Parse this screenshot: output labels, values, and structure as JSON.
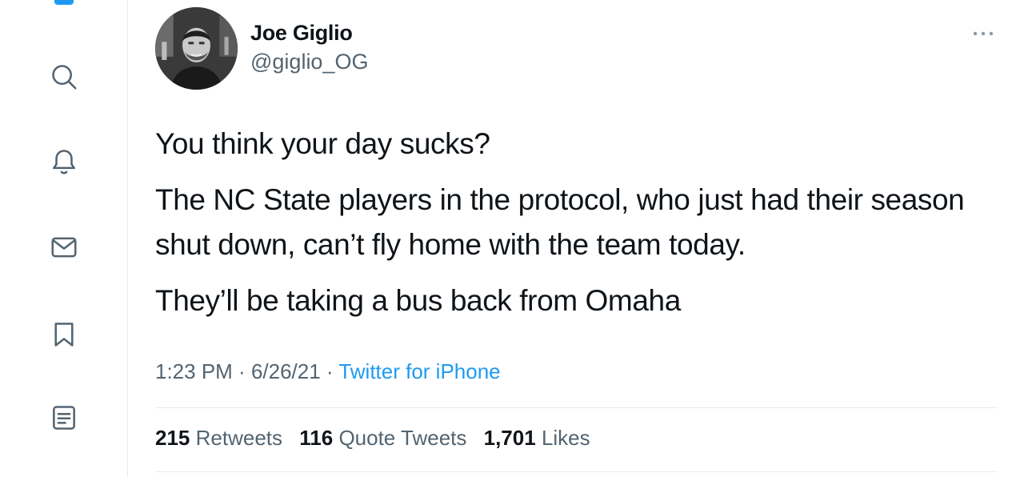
{
  "nav": {
    "icons": [
      "search-icon",
      "bell-icon",
      "mail-icon",
      "bookmark-icon",
      "list-icon"
    ]
  },
  "tweet": {
    "author": {
      "display_name": "Joe Giglio",
      "handle": "@giglio_OG"
    },
    "paragraphs": [
      "You think your day sucks?",
      "The NC State players in the protocol, who just had their season shut down, can’t fly home with the team today.",
      "They’ll be taking a bus back from Omaha"
    ],
    "time": "1:23 PM",
    "date": "6/26/21",
    "separator": " · ",
    "source": "Twitter for iPhone",
    "stats": {
      "retweets": "215",
      "retweets_label": "Retweets",
      "quote_tweets": "116",
      "quote_tweets_label": "Quote Tweets",
      "likes": "1,701",
      "likes_label": "Likes"
    }
  },
  "colors": {
    "accent": "#1d9bf0",
    "secondary_text": "#536471",
    "primary_text": "#0f1419",
    "divider": "#e6ecf0"
  }
}
